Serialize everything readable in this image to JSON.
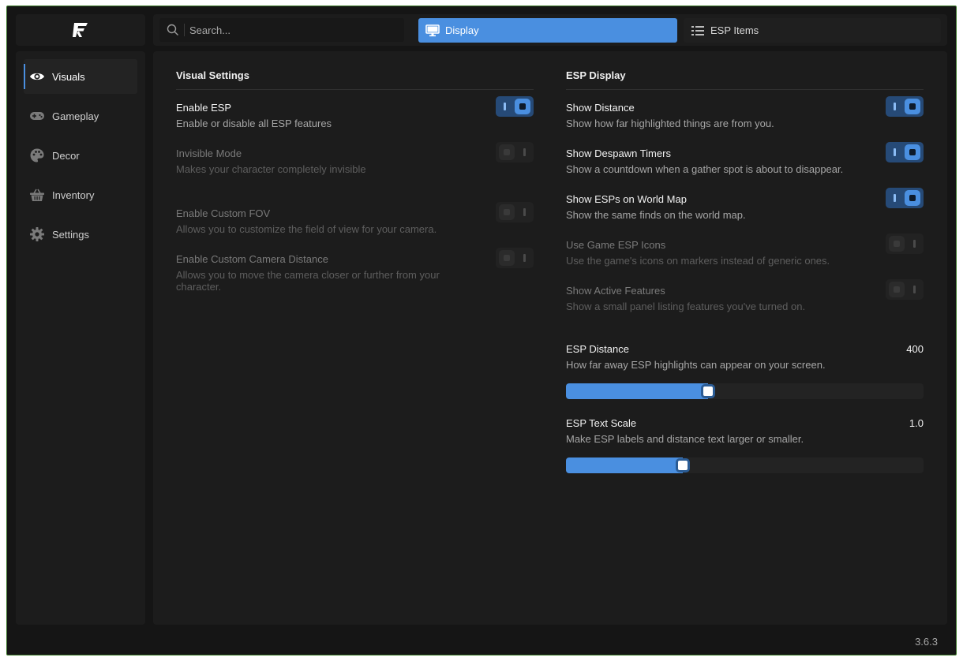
{
  "app": {
    "version": "3.6.3"
  },
  "search": {
    "placeholder": "Search..."
  },
  "tabs": [
    {
      "label": "Display",
      "icon": "monitor-icon",
      "active": true
    },
    {
      "label": "ESP Items",
      "icon": "list-icon",
      "active": false
    }
  ],
  "sidebar": {
    "items": [
      {
        "label": "Visuals",
        "icon": "eye-icon",
        "active": true
      },
      {
        "label": "Gameplay",
        "icon": "gamepad-icon",
        "active": false
      },
      {
        "label": "Decor",
        "icon": "palette-icon",
        "active": false
      },
      {
        "label": "Inventory",
        "icon": "basket-icon",
        "active": false
      },
      {
        "label": "Settings",
        "icon": "gear-icon",
        "active": false
      }
    ]
  },
  "visual_settings": {
    "heading": "Visual Settings",
    "items": [
      {
        "title": "Enable ESP",
        "desc": "Enable or disable all ESP features",
        "on": true,
        "disabled": false
      },
      {
        "title": "Invisible Mode",
        "desc": "Makes your character completely invisible",
        "on": false,
        "disabled": true
      },
      {
        "title": "Enable Custom FOV",
        "desc": "Allows you to customize the field of view for your camera.",
        "on": false,
        "disabled": true
      },
      {
        "title": "Enable Custom Camera Distance",
        "desc": "Allows you to move the camera closer or further from your character.",
        "on": false,
        "disabled": true
      }
    ]
  },
  "esp_display": {
    "heading": "ESP Display",
    "items": [
      {
        "title": "Show Distance",
        "desc": "Show how far highlighted things are from you.",
        "on": true,
        "disabled": false
      },
      {
        "title": "Show Despawn Timers",
        "desc": "Show a countdown when a gather spot is about to disappear.",
        "on": true,
        "disabled": false
      },
      {
        "title": "Show ESPs on World Map",
        "desc": "Show the same finds on the world map.",
        "on": true,
        "disabled": false
      },
      {
        "title": "Use Game ESP Icons",
        "desc": "Use the game's icons on markers instead of generic ones.",
        "on": false,
        "disabled": true
      },
      {
        "title": "Show Active Features",
        "desc": "Show a small panel listing features you've turned on.",
        "on": false,
        "disabled": true
      }
    ],
    "sliders": [
      {
        "title": "ESP Distance",
        "desc": "How far away ESP highlights can appear on your screen.",
        "value": "400",
        "fraction": 0.38
      },
      {
        "title": "ESP Text Scale",
        "desc": "Make ESP labels and distance text larger or smaller.",
        "value": "1.0",
        "fraction": 0.31
      }
    ]
  },
  "colors": {
    "accent": "#4a8fe0",
    "window_border": "#3c7a2a"
  }
}
